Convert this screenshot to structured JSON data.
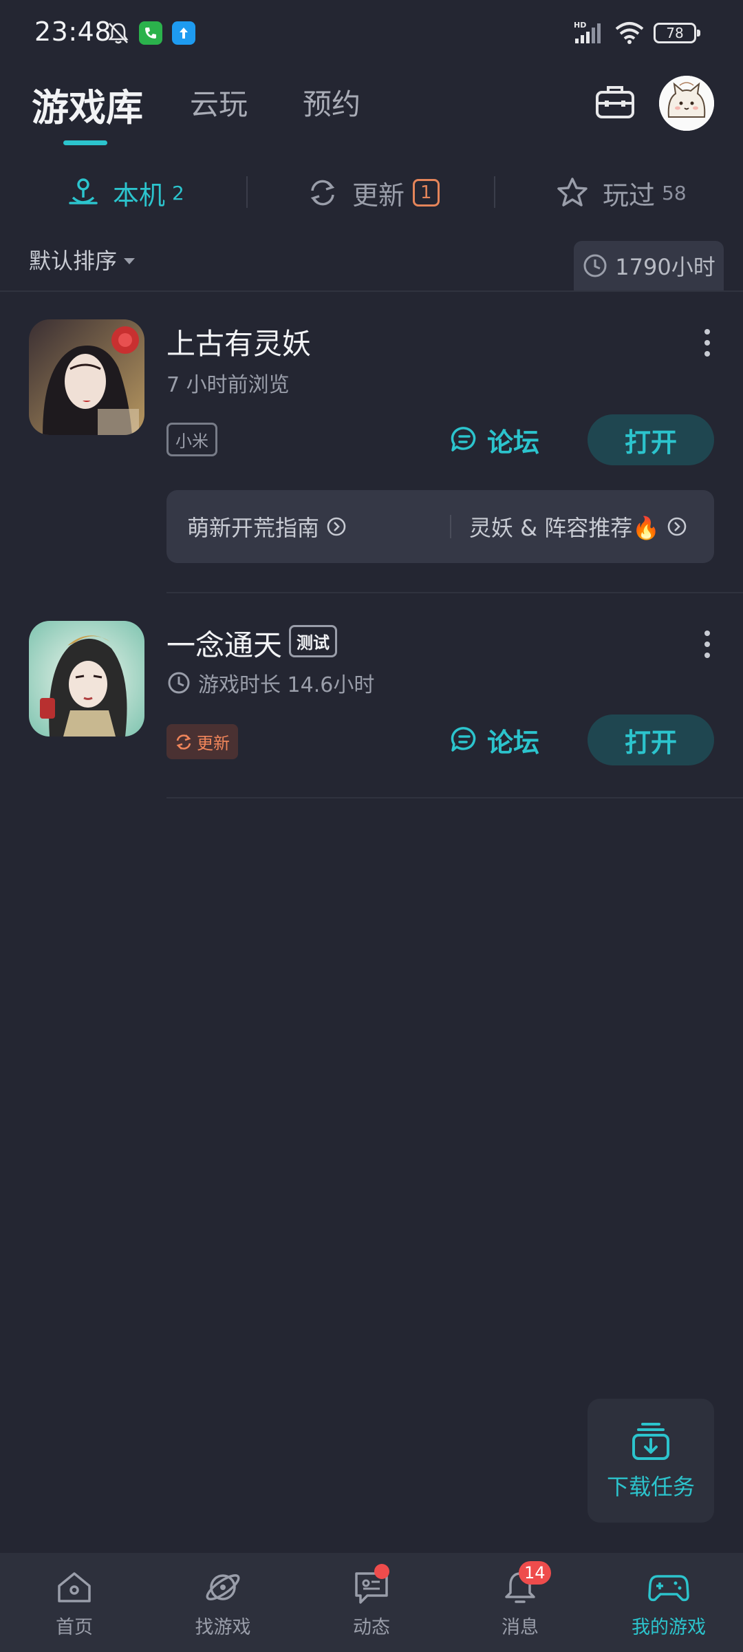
{
  "status_bar": {
    "time": "23:48",
    "battery": "78",
    "network": "HD"
  },
  "header": {
    "tabs": [
      {
        "label": "游戏库",
        "active": true
      },
      {
        "label": "云玩",
        "active": false
      },
      {
        "label": "预约",
        "active": false
      }
    ],
    "toolbox_icon": "toolbox-icon",
    "avatar_icon": "cat-avatar"
  },
  "subtabs": [
    {
      "label": "本机",
      "count": "2",
      "icon": "local-device-icon",
      "active": true
    },
    {
      "label": "更新",
      "count": "1",
      "icon": "refresh-icon",
      "active": false
    },
    {
      "label": "玩过",
      "count": "58",
      "icon": "star-icon",
      "active": false
    }
  ],
  "sort": {
    "label": "默认排序",
    "playtime": "1790小时"
  },
  "games": [
    {
      "title": "上古有灵妖",
      "subtitle": "7 小时前浏览",
      "tag": "小米",
      "forum_label": "论坛",
      "open_label": "打开",
      "guides": [
        {
          "label": "萌新开荒指南"
        },
        {
          "label": "灵妖 & 阵容推荐🔥"
        }
      ]
    },
    {
      "title": "一念通天",
      "badge": "测试",
      "subtitle": "游戏时长 14.6小时",
      "tag": "更新",
      "forum_label": "论坛",
      "open_label": "打开"
    }
  ],
  "download_task": {
    "label": "下载任务"
  },
  "bottom_nav": [
    {
      "label": "首页",
      "icon": "home-icon",
      "active": false
    },
    {
      "label": "找游戏",
      "icon": "planet-icon",
      "active": false
    },
    {
      "label": "动态",
      "icon": "chat-feed-icon",
      "active": false,
      "dot": true
    },
    {
      "label": "消息",
      "icon": "bell-icon",
      "active": false,
      "badge": "14"
    },
    {
      "label": "我的游戏",
      "icon": "gamepad-icon",
      "active": true
    }
  ],
  "colors": {
    "background": "#242632",
    "accent": "#2cc4cd",
    "update": "#e5855a",
    "badge_red": "#ee4c4c"
  }
}
